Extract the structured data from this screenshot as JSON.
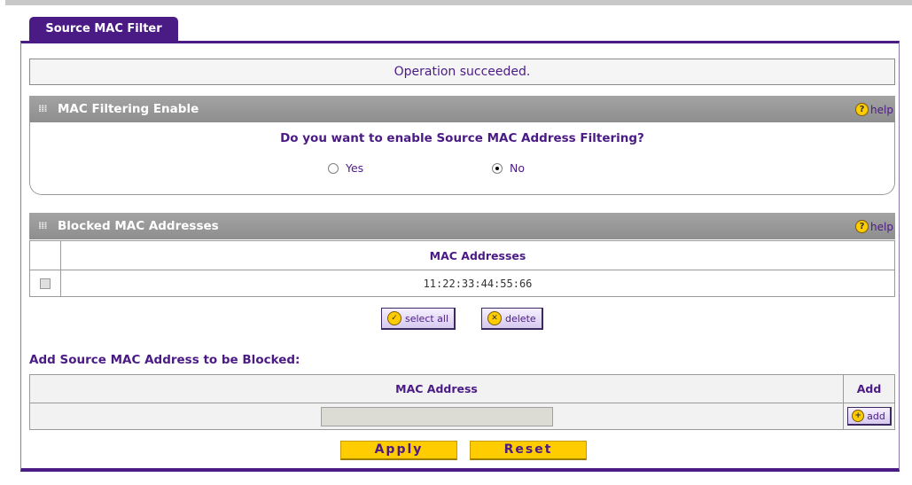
{
  "tab": {
    "label": "Source MAC Filter"
  },
  "status": {
    "message": "Operation succeeded."
  },
  "filtering": {
    "section_title": "MAC Filtering Enable",
    "help_label": "help",
    "question": "Do you want to enable Source MAC Address Filtering?",
    "options": [
      {
        "label": "Yes",
        "checked": false
      },
      {
        "label": "No",
        "checked": true
      }
    ]
  },
  "blocked": {
    "section_title": "Blocked MAC Addresses",
    "help_label": "help",
    "column_header": "MAC Addresses",
    "rows": [
      {
        "mac": "11:22:33:44:55:66",
        "selected": false
      }
    ],
    "select_all_label": "select all",
    "delete_label": "delete"
  },
  "add": {
    "heading": "Add Source MAC Address to be Blocked:",
    "column_mac": "MAC Address",
    "column_add": "Add",
    "input_value": "",
    "add_label": "add"
  },
  "actions": {
    "apply_label": "Apply",
    "reset_label": "Reset"
  },
  "colors": {
    "accent": "#4b1b85",
    "section_bar": "#9a9a9a",
    "button_yellow": "#ffcc00"
  },
  "icons": {
    "help": "help-icon",
    "select_all": "check-circle-icon",
    "delete": "x-circle-icon",
    "add": "plus-circle-icon",
    "section_grip": "grip-icon"
  }
}
